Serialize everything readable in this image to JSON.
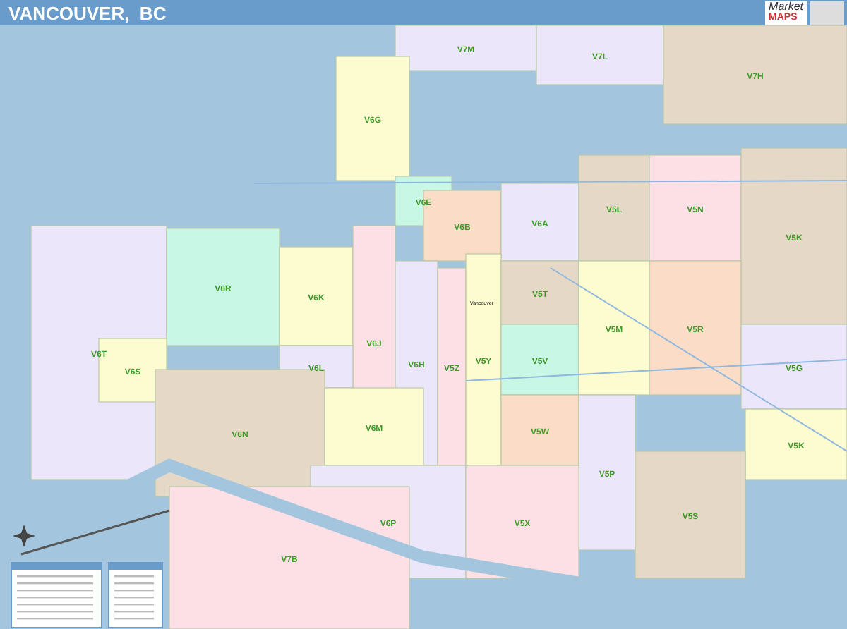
{
  "header": {
    "title": "VANCOUVER,  BC",
    "logo_top": "Market",
    "logo_bottom": "MAPS"
  },
  "city_label": "Vancouver",
  "zones": [
    {
      "label": "V7M",
      "color": "#ece6fa"
    },
    {
      "label": "V7L",
      "color": "#ece6fa"
    },
    {
      "label": "V7H",
      "color": "#e6d8c6"
    },
    {
      "label": "V6G",
      "color": "#fdfbd0"
    },
    {
      "label": "V6E",
      "color": "#c8f7e6"
    },
    {
      "label": "V6B",
      "color": "#fbdcc6"
    },
    {
      "label": "V6A",
      "color": "#ece6fa"
    },
    {
      "label": "V5L",
      "color": "#e6d8c6"
    },
    {
      "label": "V5N",
      "color": "#fde0e6"
    },
    {
      "label": "V5K",
      "color": "#e6d8c6"
    },
    {
      "label": "V6T",
      "color": "#ece6fa"
    },
    {
      "label": "V6R",
      "color": "#c8f7e6"
    },
    {
      "label": "V6K",
      "color": "#fdfbd0"
    },
    {
      "label": "V6J",
      "color": "#fde0e6"
    },
    {
      "label": "V6H",
      "color": "#ece6fa"
    },
    {
      "label": "V5Z",
      "color": "#fde0e6"
    },
    {
      "label": "V5Y",
      "color": "#fdfbd0"
    },
    {
      "label": "V5T",
      "color": "#e6d8c6"
    },
    {
      "label": "V5V",
      "color": "#c8f7e6"
    },
    {
      "label": "V5M",
      "color": "#fdfbd0"
    },
    {
      "label": "V5R",
      "color": "#fbdcc6"
    },
    {
      "label": "V5G",
      "color": "#ece6fa"
    },
    {
      "label": "V6S",
      "color": "#fdfbd0"
    },
    {
      "label": "V6L",
      "color": "#ece6fa"
    },
    {
      "label": "V6N",
      "color": "#e6d8c6"
    },
    {
      "label": "V6M",
      "color": "#fdfbd0"
    },
    {
      "label": "V5W",
      "color": "#fbdcc6"
    },
    {
      "label": "V5P",
      "color": "#ece6fa"
    },
    {
      "label": "V5K",
      "color": "#fdfbd0"
    },
    {
      "label": "V6P",
      "color": "#ece6fa"
    },
    {
      "label": "V5X",
      "color": "#fde0e6"
    },
    {
      "label": "V5S",
      "color": "#e6d8c6"
    },
    {
      "label": "V7B",
      "color": "#fde0e6"
    }
  ]
}
